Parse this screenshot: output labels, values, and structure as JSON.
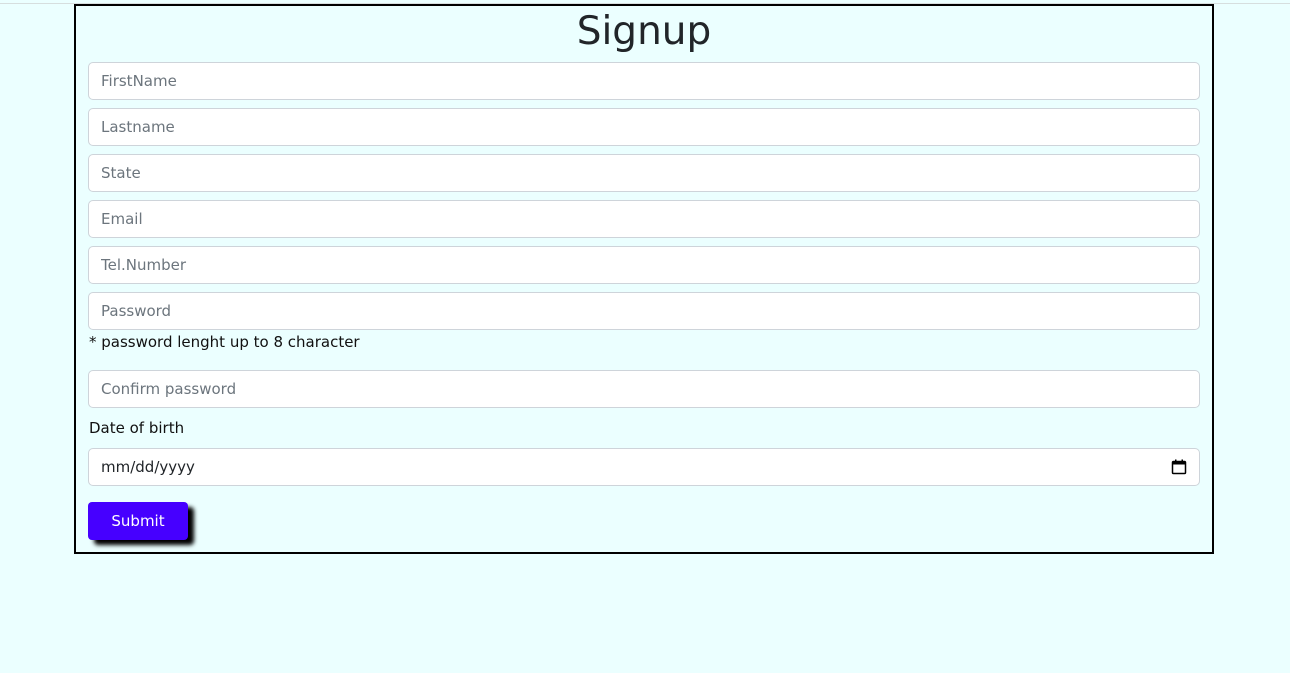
{
  "form": {
    "title": "Signup",
    "fields": {
      "firstname_placeholder": "FirstName",
      "lastname_placeholder": "Lastname",
      "state_placeholder": "State",
      "email_placeholder": "Email",
      "tel_placeholder": "Tel.Number",
      "password_placeholder": "Password",
      "confirm_password_placeholder": "Confirm password"
    },
    "password_hint": "* password lenght up to 8 character",
    "dob_label": "Date of birth",
    "dob_value": "mm/dd/yyyy",
    "submit_label": "Submit"
  },
  "icons": {
    "date": "calendar-icon"
  },
  "colors": {
    "page_background": "#ebffff",
    "submit_button": "#4600ff",
    "border": "#000000"
  }
}
